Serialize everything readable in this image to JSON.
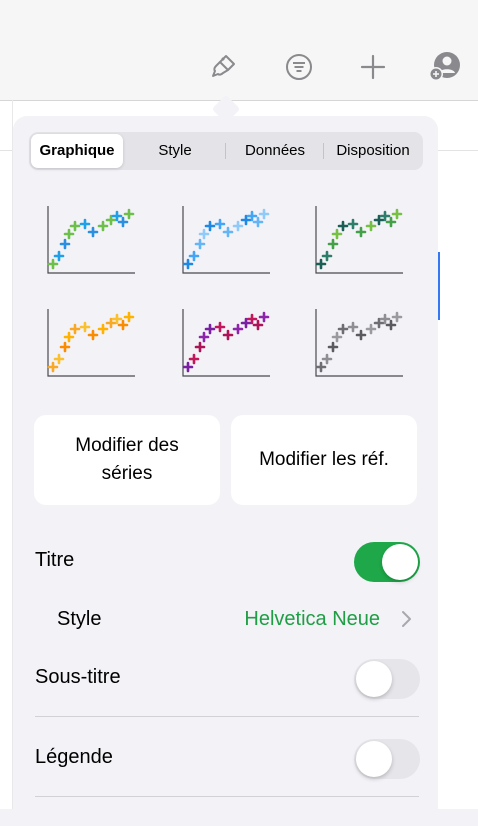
{
  "colors": {
    "accent_green": "#1fa84a",
    "toggle_off": "#e5e5ea",
    "value_green": "#1f9e45",
    "chevron_gray": "#a8a8ad",
    "icon_gray": "#8a8a8e"
  },
  "toolbar": {
    "icons": [
      "paintbrush-icon",
      "filter-icon",
      "plus-icon",
      "collaborate-icon"
    ]
  },
  "tabs": [
    {
      "label": "Graphique",
      "active": true
    },
    {
      "label": "Style",
      "active": false
    },
    {
      "label": "Données",
      "active": false
    },
    {
      "label": "Disposition",
      "active": false
    }
  ],
  "chart_styles": [
    {
      "name": "multicolor",
      "colors": [
        "#6cc04a",
        "#1fa0e8",
        "#2a8fe0",
        "#6cc04a"
      ]
    },
    {
      "name": "blue",
      "colors": [
        "#1e88e5",
        "#42a5f5",
        "#64b5f6",
        "#90caf9"
      ]
    },
    {
      "name": "teal-green",
      "colors": [
        "#1b5e56",
        "#2e7d6a",
        "#43a047",
        "#76c043"
      ]
    },
    {
      "name": "orange",
      "colors": [
        "#f9a825",
        "#fbc02d",
        "#fb8c00",
        "#ffb300"
      ]
    },
    {
      "name": "purple-pink",
      "colors": [
        "#7b1fa2",
        "#c2185b",
        "#ad1457",
        "#8e24aa"
      ]
    },
    {
      "name": "gray",
      "colors": [
        "#6d6d72",
        "#8e8e93",
        "#5a5a5f",
        "#9a9a9f"
      ]
    }
  ],
  "buttons": {
    "edit_series": "Modifier des séries",
    "edit_refs": "Modifier les réf."
  },
  "settings": {
    "title_label": "Titre",
    "title_on": true,
    "style_label": "Style",
    "style_value": "Helvetica Neue",
    "subtitle_label": "Sous-titre",
    "subtitle_on": false,
    "legend_label": "Légende",
    "legend_on": false
  }
}
